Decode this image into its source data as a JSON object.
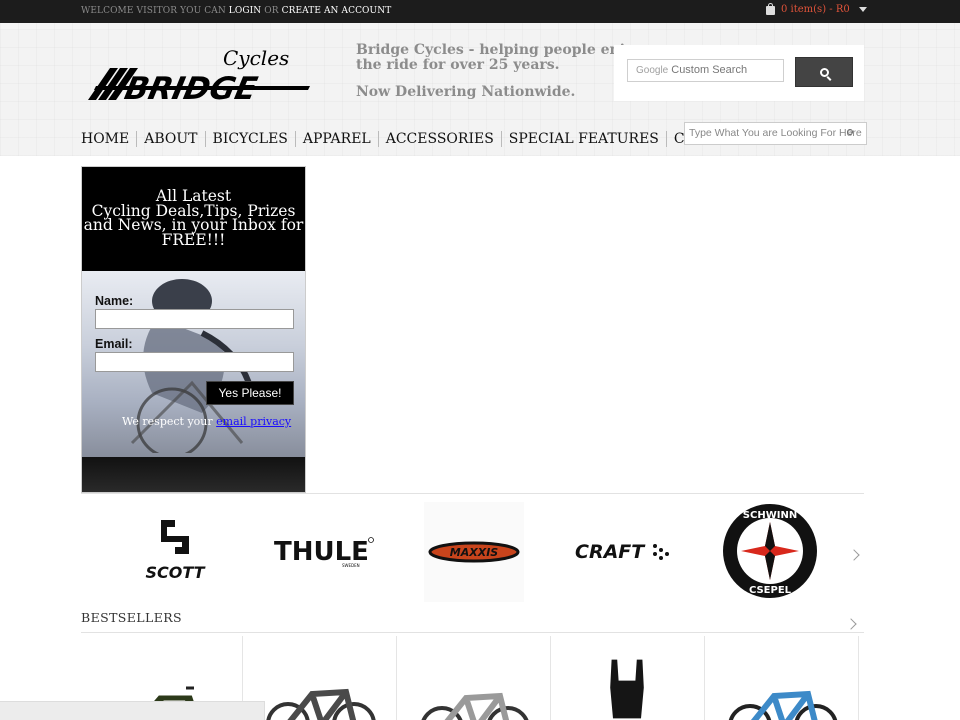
{
  "topbar": {
    "welcome_prefix": "WELCOME VISITOR YOU CAN",
    "login": "LOGIN",
    "or": "OR",
    "create_account": "CREATE AN ACCOUNT",
    "cart": "0 item(s) - R0"
  },
  "header": {
    "logo_top": "Cycles",
    "logo_main": "BRIDGE",
    "tagline_line1": "Bridge Cycles - helping people enjoy",
    "tagline_line2": "the ride for over 25 years.",
    "tagline2": "Now Delivering Nationwide.",
    "google_label": "Google",
    "search_placeholder": "Custom Search",
    "site_search_placeholder": "Type What You are Looking For Here"
  },
  "nav": [
    "HOME",
    "ABOUT",
    "BICYCLES",
    "APPAREL",
    "ACCESSORIES",
    "SPECIAL FEATURES",
    "CONTACT"
  ],
  "signup": {
    "line1": "All Latest",
    "line2": "Cycling Deals,Tips, Prizes",
    "line3": "and News, in your Inbox for",
    "line4": "FREE!!!",
    "name_label": "Name:",
    "email_label": "Email:",
    "button": "Yes Please!",
    "privacy_prefix": "We respect your ",
    "privacy_link": "email privacy"
  },
  "brands": {
    "scott": "SCOTT",
    "thule": "THULE",
    "thule_sub": "SWEDEN",
    "maxxis": "MAXXIS",
    "craft": "CRAFT",
    "schwinn_top": "SCHWINN",
    "schwinn_bottom": "CSEPEL"
  },
  "bestsellers": {
    "title": "BESTSELLERS"
  },
  "colors": {
    "topbar_bg": "#1c1c1c",
    "cart_text": "#e0533a",
    "link_blue": "#1a0dff",
    "button_dark": "#444444"
  }
}
